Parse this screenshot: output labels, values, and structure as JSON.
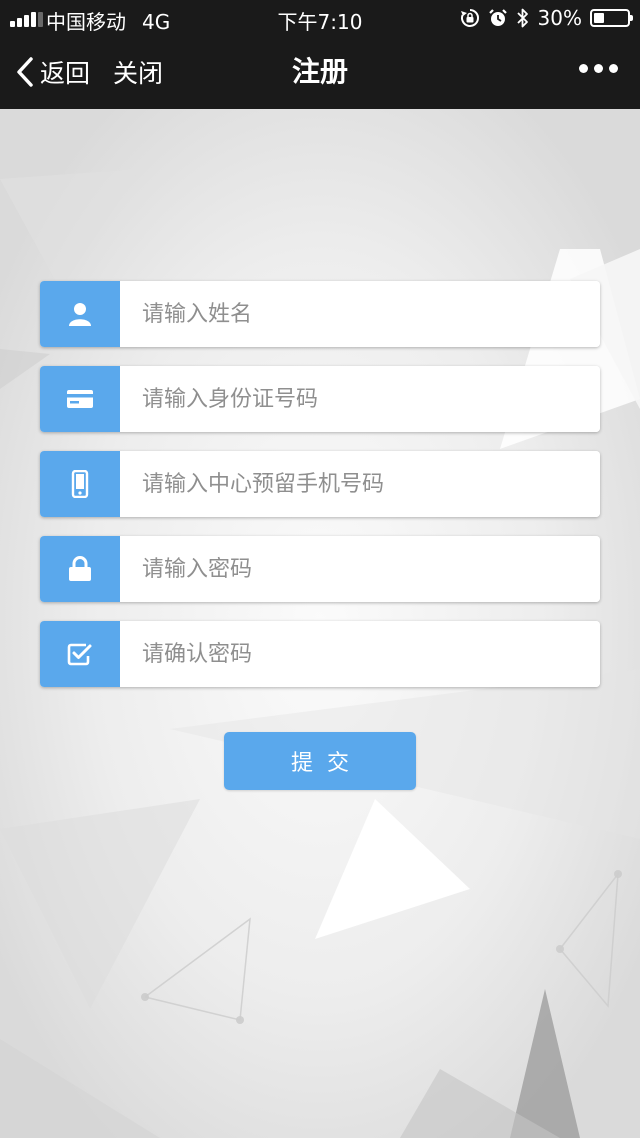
{
  "status_bar": {
    "carrier": "中国移动",
    "network": "4G",
    "time": "下午7:10",
    "battery_text": "30%",
    "battery_level": 0.3,
    "icons": [
      "signal-icon",
      "rotation-lock-icon",
      "alarm-icon",
      "bluetooth-icon",
      "battery-icon"
    ]
  },
  "nav": {
    "back_label": "返回",
    "close_label": "关闭",
    "title": "注册",
    "more_icon": "more-icon"
  },
  "form": {
    "name_placeholder": "请输入姓名",
    "id_placeholder": "请输入身份证号码",
    "phone_placeholder": "请输入中心预留手机号码",
    "password_placeholder": "请输入密码",
    "confirm_placeholder": "请确认密码",
    "icons": [
      "user-icon",
      "card-icon",
      "phone-icon",
      "lock-icon",
      "checkbox-icon"
    ]
  },
  "submit_label": "提交",
  "colors": {
    "accent": "#5aa8ec",
    "nav_background": "#1a1a1a",
    "page_background": "#e9e9e9"
  }
}
